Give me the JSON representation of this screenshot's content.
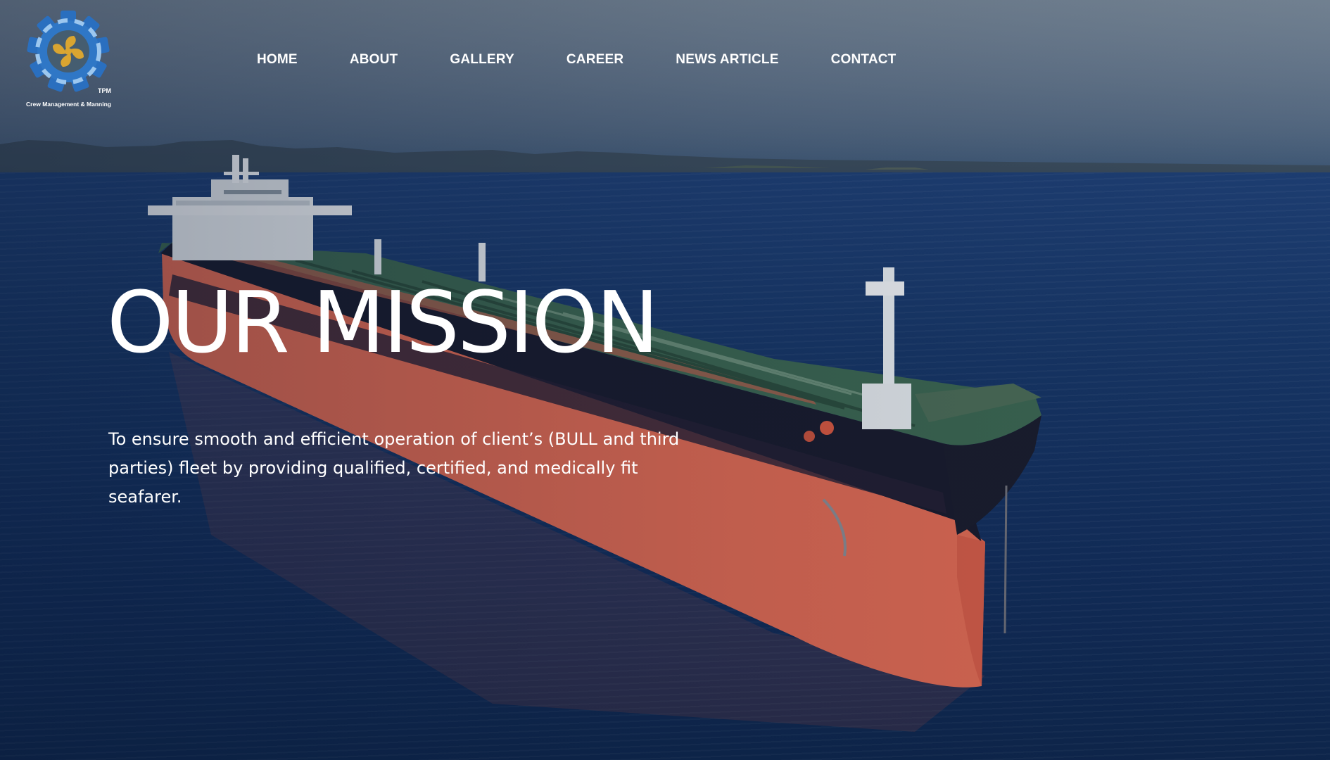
{
  "logo": {
    "icon": "gear-propeller-logo-icon",
    "mark": "TPM",
    "tagline": "Crew Management & Manning"
  },
  "nav": {
    "items": [
      {
        "label": "HOME"
      },
      {
        "label": "ABOUT"
      },
      {
        "label": "GALLERY"
      },
      {
        "label": "CAREER"
      },
      {
        "label": "NEWS ARTICLE"
      },
      {
        "label": "CONTACT"
      }
    ]
  },
  "hero": {
    "title": "OUR MISSION",
    "description": "To ensure smooth and efficient operation of client’s (BULL and third parties) fleet by providing qualified, certified, and medically fit seafarer.",
    "background": "oil-tanker-ship-at-sea"
  },
  "colors": {
    "text": "#ffffff",
    "sea": "#14305f",
    "hull": "#e2694f",
    "deck": "#3f6a52",
    "logo_blue": "#1f5fa8",
    "logo_gold": "#d9a531"
  }
}
